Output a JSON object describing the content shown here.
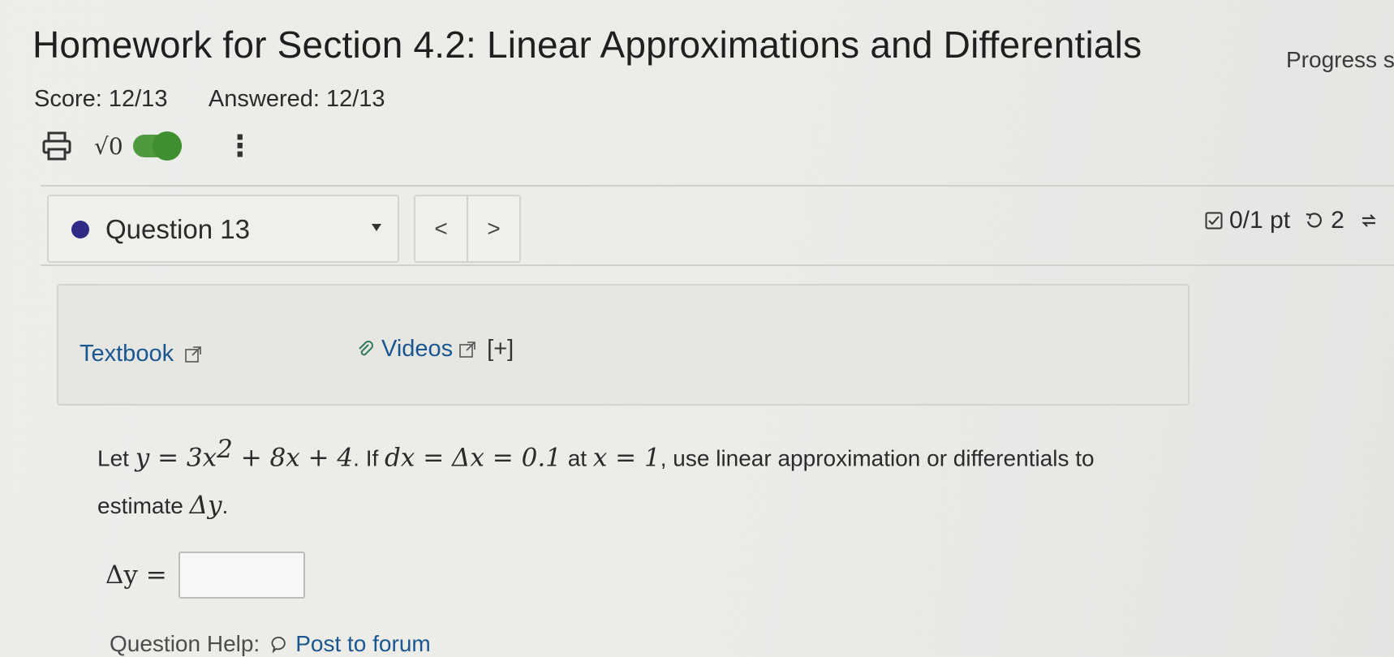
{
  "header": {
    "title": "Homework for Section 4.2: Linear Approximations and Differentials",
    "progress_label": "Progress s"
  },
  "score": {
    "score_text": "Score: 12/13",
    "answered_text": "Answered: 12/13"
  },
  "toolbar": {
    "math_symbol": "√0",
    "icons": [
      "print-icon",
      "sqrt-icon",
      "toggle-switch",
      "more-vertical-icon"
    ],
    "toggle_color": "#4f9a3e"
  },
  "question_nav": {
    "selected": "Question 13",
    "prev": "<",
    "next": ">",
    "dot_color": "#2e2a86"
  },
  "points": {
    "score": "0/1 pt",
    "retries": "2"
  },
  "resources": {
    "textbook": "Textbook",
    "videos": "Videos",
    "expand": "[+]",
    "link_color": "#1a5790"
  },
  "question": {
    "let": "Let ",
    "equation": "y = 3x",
    "exp": "2",
    "equation_rest": " + 8x + 4",
    "if": ". If ",
    "differential": "dx = Δx = 0.1",
    "at": " at ",
    "point": "x = 1",
    "rest": ", use linear approximation or differentials to estimate ",
    "target": "Δy",
    "end": "."
  },
  "answer": {
    "label": "Δy =",
    "value": ""
  },
  "help": {
    "label": "Question Help:",
    "forum": "Post to forum"
  }
}
